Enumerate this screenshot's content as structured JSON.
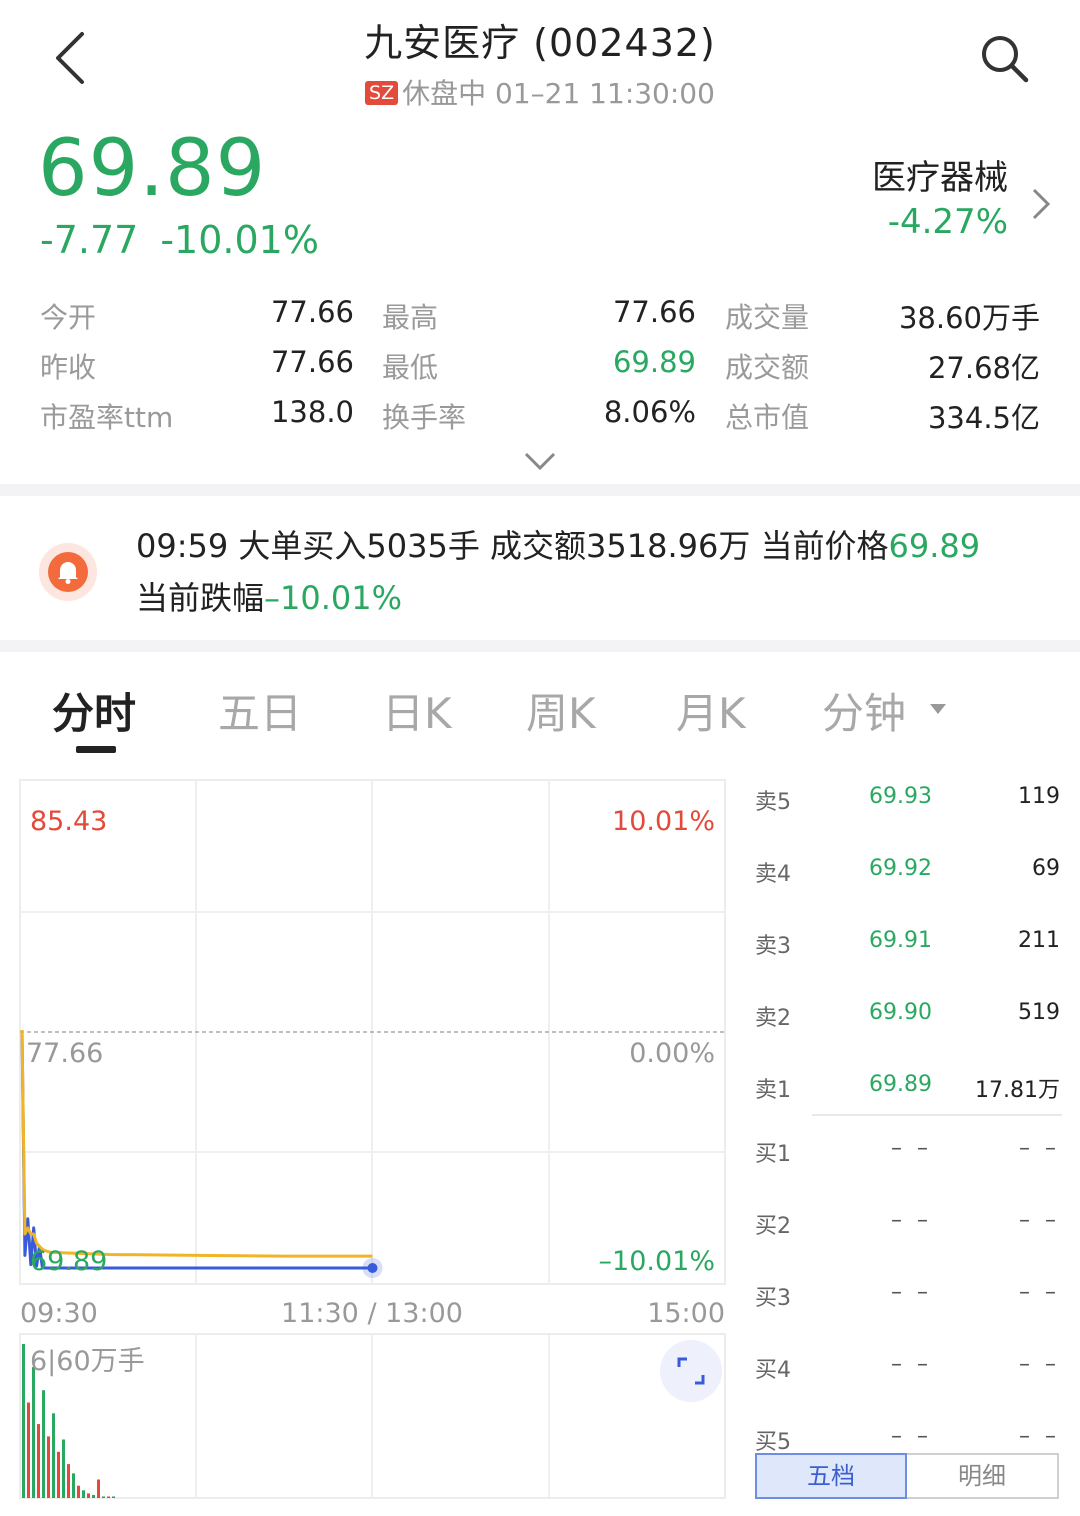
{
  "header": {
    "title": "九安医疗 (002432)",
    "market_badge": "SZ",
    "status": "休盘中 01–21 11:30:00"
  },
  "quote": {
    "price": "69.89",
    "change_abs": "-7.77",
    "change_pct": "-10.01%",
    "sector_name": "医疗器械",
    "sector_change": "-4.27%"
  },
  "stats": [
    {
      "label": "今开",
      "value": "77.66",
      "color": "#222222"
    },
    {
      "label": "最高",
      "value": "77.66",
      "color": "#222222"
    },
    {
      "label": "成交量",
      "value": "38.60万手",
      "color": "#222222"
    },
    {
      "label": "昨收",
      "value": "77.66",
      "color": "#222222"
    },
    {
      "label": "最低",
      "value": "69.89",
      "color": "#2aa861"
    },
    {
      "label": "成交额",
      "value": "27.68亿",
      "color": "#222222"
    },
    {
      "label": "市盈率ttm",
      "value": "138.0",
      "color": "#222222"
    },
    {
      "label": "换手率",
      "value": "8.06%",
      "color": "#222222"
    },
    {
      "label": "总市值",
      "value": "334.5亿",
      "color": "#222222"
    }
  ],
  "news": {
    "line1_prefix": "09:59 大单买入5035手 成交额3518.96万 当前价格",
    "line1_price": "69.89",
    "line2_prefix": "当前跌幅",
    "line2_pct": "–10.01%"
  },
  "tabs": [
    {
      "label": "分时",
      "active": true
    },
    {
      "label": "五日",
      "active": false
    },
    {
      "label": "日K",
      "active": false
    },
    {
      "label": "周K",
      "active": false
    },
    {
      "label": "月K",
      "active": false
    },
    {
      "label": "分钟",
      "active": false
    }
  ],
  "chart_data": {
    "type": "line",
    "y_labels_left": {
      "top": "85.43",
      "mid": "77.66",
      "bottom": "69.89"
    },
    "y_labels_right": {
      "top": "10.01%",
      "mid": "0.00%",
      "bottom": "–10.01%"
    },
    "x_labels": {
      "start": "09:30",
      "mid": "11:30 / 13:00",
      "end": "15:00"
    },
    "ylim": [
      69.89,
      85.43
    ],
    "prev_close": 77.66,
    "x": [
      "09:30",
      "09:31",
      "09:32",
      "09:33",
      "09:34",
      "09:35",
      "09:36",
      "09:37",
      "09:38",
      "09:40",
      "10:00",
      "10:30",
      "11:00",
      "11:30"
    ],
    "series": [
      {
        "name": "price",
        "color": "#3a5bd9",
        "values": [
          77.66,
          70.3,
          71.5,
          70.0,
          71.2,
          69.95,
          70.6,
          69.9,
          69.89,
          69.89,
          69.89,
          69.89,
          69.89,
          69.89
        ]
      },
      {
        "name": "avg",
        "color": "#f0b429",
        "values": [
          77.66,
          71.0,
          71.2,
          71.0,
          71.0,
          70.7,
          70.6,
          70.5,
          70.45,
          70.4,
          70.33,
          70.3,
          70.28,
          70.28
        ]
      }
    ],
    "volume_label": "6|60万手",
    "volume_values": [
      100,
      62,
      85,
      48,
      70,
      40,
      55,
      30,
      38,
      22,
      16,
      8,
      5,
      3,
      2,
      12,
      1,
      1,
      1
    ]
  },
  "order_book": {
    "asks": [
      {
        "label": "卖5",
        "price": "69.93",
        "vol": "119"
      },
      {
        "label": "卖4",
        "price": "69.92",
        "vol": "69"
      },
      {
        "label": "卖3",
        "price": "69.91",
        "vol": "211"
      },
      {
        "label": "卖2",
        "price": "69.90",
        "vol": "519"
      },
      {
        "label": "卖1",
        "price": "69.89",
        "vol": "17.81万"
      }
    ],
    "bids": [
      {
        "label": "买1",
        "price": "– –",
        "vol": "– –"
      },
      {
        "label": "买2",
        "price": "– –",
        "vol": "– –"
      },
      {
        "label": "买3",
        "price": "– –",
        "vol": "– –"
      },
      {
        "label": "买4",
        "price": "– –",
        "vol": "– –"
      },
      {
        "label": "买5",
        "price": "– –",
        "vol": "– –"
      }
    ],
    "tab_five": "五档",
    "tab_detail": "明细"
  },
  "colors": {
    "down": "#2aa861",
    "up": "#e34a3a",
    "accent": "#3a5bd9"
  }
}
